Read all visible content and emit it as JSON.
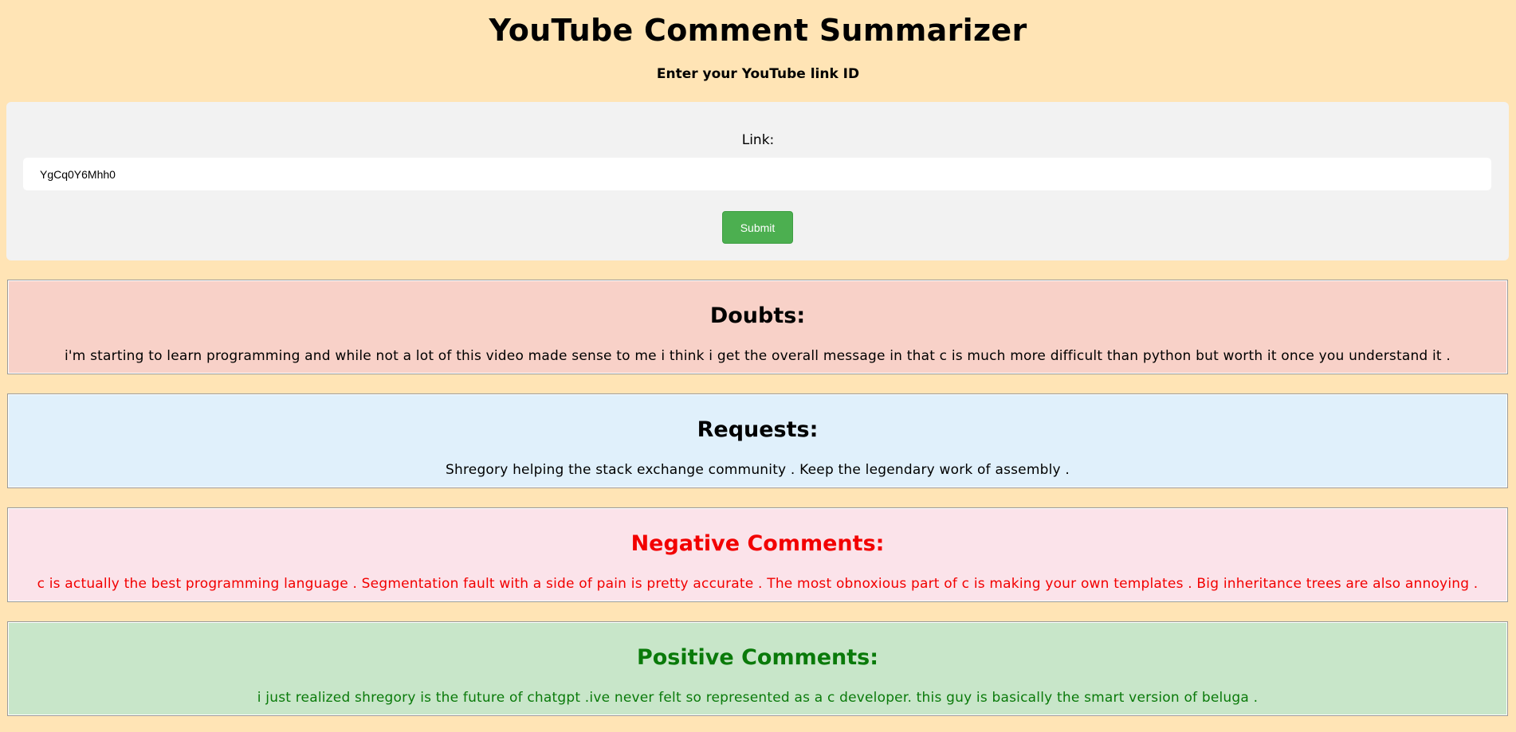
{
  "header": {
    "title": "YouTube Comment Summarizer",
    "subtitle": "Enter your YouTube link ID"
  },
  "form": {
    "link_label": "Link:",
    "link_value": "YgCq0Y6Mhh0",
    "submit_label": "Submit"
  },
  "sections": {
    "doubts": {
      "heading": "Doubts:",
      "body": "i'm starting to learn programming and while not a lot of this video made sense to me i think i get the overall message in that c is much more difficult than python but worth it once you understand it ."
    },
    "requests": {
      "heading": "Requests:",
      "body": "Shregory helping the stack exchange community . Keep the legendary work of assembly ."
    },
    "negative": {
      "heading": "Negative Comments:",
      "body": "c is actually the best programming language . Segmentation fault with a side of pain is pretty accurate . The most obnoxious part of c is making your own templates . Big inheritance trees are also annoying ."
    },
    "positive": {
      "heading": "Positive Comments:",
      "body": "i just realized shregory is the future of chatgpt .ive never felt so represented as a c developer. this guy is basically the smart version of beluga ."
    }
  },
  "colors": {
    "page_background": "#ffe4b5",
    "submit_green": "#4caf50",
    "doubts_background": "#f8d1c8",
    "requests_background": "#e0f0fb",
    "negative_background": "#fbe3ea",
    "negative_text": "#f20000",
    "positive_background": "#c8e6c9",
    "positive_text": "#0a7a0a"
  }
}
